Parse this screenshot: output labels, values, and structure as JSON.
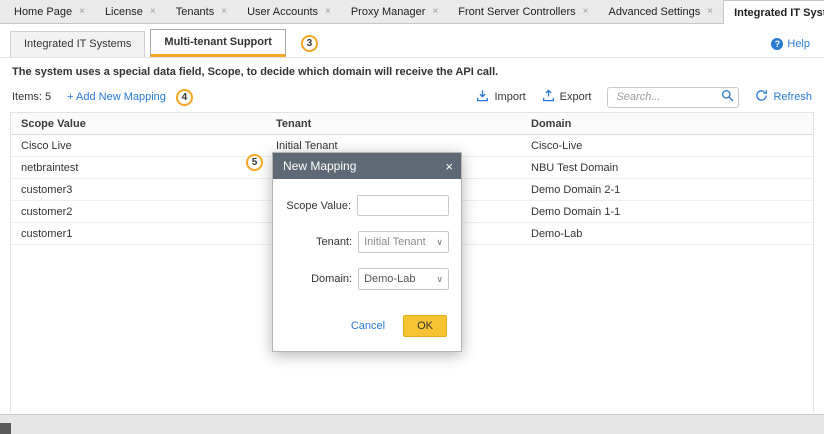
{
  "ui": {
    "close_glyph": "×",
    "select_chevron": "∨",
    "help_icon_glyph": "?"
  },
  "colors": {
    "accent_orange": "#f5a623",
    "link_blue": "#2979d1",
    "ok_button_yellow": "#f7c331",
    "dialog_header_gray": "#5d6a75"
  },
  "main_tabs": {
    "items": [
      {
        "label": "Home Page",
        "active": false
      },
      {
        "label": "License",
        "active": false
      },
      {
        "label": "Tenants",
        "active": false
      },
      {
        "label": "User Accounts",
        "active": false
      },
      {
        "label": "Proxy Manager",
        "active": false
      },
      {
        "label": "Front Server Controllers",
        "active": false
      },
      {
        "label": "Advanced Settings",
        "active": false
      },
      {
        "label": "Integrated IT Systems",
        "active": true
      }
    ]
  },
  "sub_tabs": {
    "items": [
      {
        "label": "Integrated IT Systems",
        "active": false
      },
      {
        "label": "Multi-tenant Support",
        "active": true
      }
    ],
    "help_label": "Help"
  },
  "annotations": {
    "step3": "3",
    "step4": "4",
    "step5": "5"
  },
  "description": "The system uses a special data field, Scope, to decide which domain will receive the API call.",
  "toolbar": {
    "items_count": "Items: 5",
    "add_new_mapping": "+ Add New Mapping",
    "import_label": "Import",
    "export_label": "Export",
    "search_placeholder": "Search...",
    "refresh_label": "Refresh"
  },
  "table": {
    "columns": [
      "Scope Value",
      "Tenant",
      "Domain"
    ],
    "rows": [
      {
        "scope": "Cisco Live",
        "tenant": "Initial Tenant",
        "domain": "Cisco-Live"
      },
      {
        "scope": "netbraintest",
        "tenant": "",
        "domain": "NBU Test Domain"
      },
      {
        "scope": "customer3",
        "tenant": "",
        "domain": "Demo Domain 2-1"
      },
      {
        "scope": "customer2",
        "tenant": "",
        "domain": "Demo Domain 1-1"
      },
      {
        "scope": "customer1",
        "tenant": "",
        "domain": "Demo-Lab"
      }
    ]
  },
  "dialog": {
    "title": "New Mapping",
    "fields": [
      {
        "label": "Scope Value:",
        "type": "input",
        "value": ""
      },
      {
        "label": "Tenant:",
        "type": "select",
        "value": "Initial Tenant"
      },
      {
        "label": "Domain:",
        "type": "select",
        "value": "Demo-Lab"
      }
    ],
    "cancel_label": "Cancel",
    "ok_label": "OK"
  }
}
